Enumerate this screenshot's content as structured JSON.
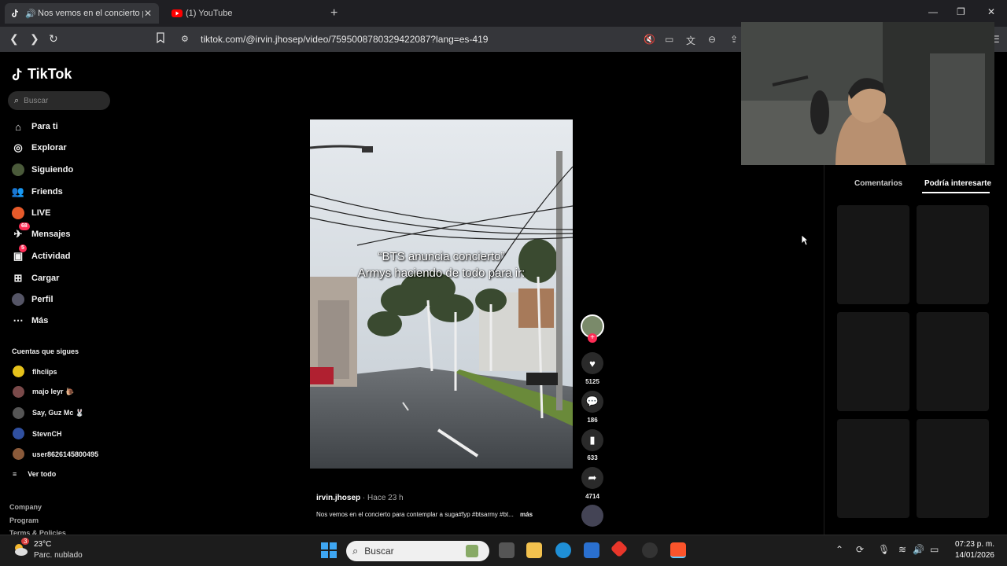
{
  "browser": {
    "tabs": [
      {
        "title": "Nos vemos en el concierto pa",
        "icon": "tiktok-icon",
        "active": true
      },
      {
        "title": "(1) YouTube",
        "icon": "youtube-icon",
        "active": false
      }
    ],
    "url": "tiktok.com/@irvin.jhosep/video/7595008780329422087?lang=es-419"
  },
  "tiktok": {
    "logo": "TikTok",
    "search_placeholder": "Buscar",
    "nav": [
      {
        "label": "Para ti",
        "icon": "home-icon"
      },
      {
        "label": "Explorar",
        "icon": "compass-icon"
      },
      {
        "label": "Siguiendo",
        "icon": "following-icon"
      },
      {
        "label": "Friends",
        "icon": "friends-icon"
      },
      {
        "label": "LIVE",
        "icon": "live-icon"
      },
      {
        "label": "Mensajes",
        "icon": "messages-icon",
        "badge": "68"
      },
      {
        "label": "Actividad",
        "icon": "activity-icon",
        "badge": "5"
      },
      {
        "label": "Cargar",
        "icon": "upload-icon"
      },
      {
        "label": "Perfil",
        "icon": "profile-icon"
      },
      {
        "label": "Más",
        "icon": "more-icon"
      }
    ],
    "following_heading": "Cuentas que sigues",
    "following": [
      {
        "name": "flhclips",
        "color": "#e6c21b"
      },
      {
        "name": "majo leyr 🐌",
        "color": "#7a4a4a"
      },
      {
        "name": "Say, Guz Mc 🐰",
        "color": "#555"
      },
      {
        "name": "StevnCH",
        "color": "#3050a0"
      },
      {
        "name": "user8626145800495",
        "color": "#8a5a3a"
      }
    ],
    "see_all": "Ver todo",
    "footer": [
      "Company",
      "Program",
      "Terms & Policies"
    ]
  },
  "video": {
    "caption_line1": "“BTS anuncia concierto”",
    "caption_line2": "Armys haciendo de todo para ir:",
    "author": "irvin.jhosep",
    "posted": "Hace 23 h",
    "separator": "·",
    "description": "Nos vemos en el concierto para contemplar a suga#fyp #btsarmy #bt...",
    "more": "más",
    "likes": "5125",
    "comments": "186",
    "saves": "633",
    "shares": "4714"
  },
  "side_panel": {
    "tab_comments": "Comentarios",
    "tab_recommended": "Podría interesarte"
  },
  "taskbar": {
    "temperature": "23°C",
    "condition": "Parc. nublado",
    "weather_badge": "3",
    "search_placeholder": "Buscar",
    "time": "07:23 p. m.",
    "date": "14/01/2026"
  },
  "colors": {
    "accent": "#fe2c55",
    "background": "#000000"
  }
}
